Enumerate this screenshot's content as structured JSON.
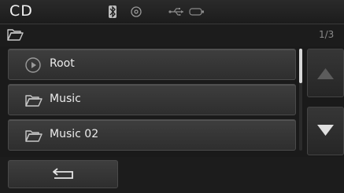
{
  "header": {
    "mode_title": "CD",
    "icons": [
      "bluetooth-icon",
      "disc-icon",
      "usb-icon",
      "ipod-icon"
    ]
  },
  "path": {
    "page_indicator": "1/3"
  },
  "list": {
    "items": [
      {
        "label": "Root",
        "icon": "play-circle-icon"
      },
      {
        "label": "Music",
        "icon": "folder-icon"
      },
      {
        "label": "Music 02",
        "icon": "folder-icon"
      }
    ]
  },
  "controls": {
    "back_icon": "back-arrow-icon"
  },
  "colors": {
    "background": "#1a1a1a",
    "item": "#353535",
    "text": "#ececec"
  }
}
